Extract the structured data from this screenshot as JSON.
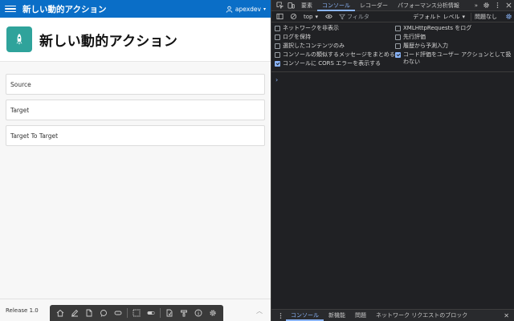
{
  "app": {
    "title": "新しい動的アクション",
    "user": "apexdev",
    "hero_title": "新しい動的アクション",
    "regions": [
      {
        "label": "Source"
      },
      {
        "label": "Target"
      },
      {
        "label": "Target To Target"
      }
    ],
    "release": "Release 1.0",
    "colors": {
      "header": "#0a6ec7",
      "hero_icon": "#2fa39b"
    }
  },
  "devtools": {
    "tabs": [
      {
        "label": "要素"
      },
      {
        "label": "コンソール",
        "active": true
      },
      {
        "label": "レコーダー"
      },
      {
        "label": "パフォーマンス分析情報"
      }
    ],
    "context": "top",
    "filter_placeholder": "フィルタ",
    "level": "デフォルト レベル",
    "issues": "問題なし",
    "settings_left": [
      {
        "label": "ネットワークを非表示",
        "checked": false
      },
      {
        "label": "ログを保持",
        "checked": false
      },
      {
        "label": "選択したコンテンツのみ",
        "checked": false
      },
      {
        "label": "コンソールの類似するメッセージをまとめる",
        "checked": false
      },
      {
        "label": "コンソールに CORS エラーを表示する",
        "checked": true
      }
    ],
    "settings_right": [
      {
        "label": "XMLHttpRequests をログ",
        "checked": false
      },
      {
        "label": "先行評価",
        "checked": false
      },
      {
        "label": "履歴から予測入力",
        "checked": false
      },
      {
        "label": "コード評価をユーザー アクションとして扱わない",
        "checked": true
      }
    ],
    "prompt": "›",
    "drawer_tabs": [
      {
        "label": "コンソール",
        "active": true
      },
      {
        "label": "新機能"
      },
      {
        "label": "問題"
      },
      {
        "label": "ネットワーク リクエストのブロック"
      }
    ]
  }
}
